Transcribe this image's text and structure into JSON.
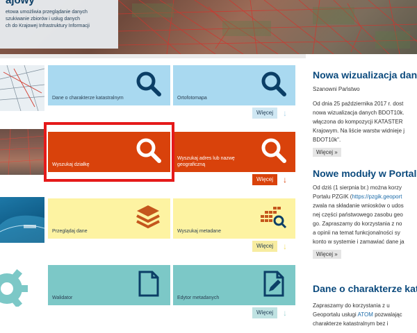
{
  "banner": {
    "title": "ajowy",
    "lines": [
      "etowa umożliwia przeglądanie danych",
      "szukiwanie zbiorów i usług danych",
      "ch do Krajowej Infrastruktury Informacji"
    ]
  },
  "tiles": [
    {
      "label": "Dane o charakterze katastralnym",
      "color": "blue",
      "icon": "search-icon"
    },
    {
      "label": "Ortofotomapa",
      "color": "blue",
      "icon": "search-icon"
    },
    {
      "label": "Wyszukaj działkę",
      "color": "red",
      "icon": "search-icon"
    },
    {
      "label": "Wyszukaj adres lub nazwę geograficzną",
      "color": "red",
      "icon": "search-icon"
    },
    {
      "label": "Przeglądaj dane",
      "color": "yellow",
      "icon": "layers-icon"
    },
    {
      "label": "Wyszukaj metadane",
      "color": "yellow",
      "icon": "grid-search-icon"
    },
    {
      "label": "Walidator",
      "color": "teal",
      "icon": "document-icon"
    },
    {
      "label": "Edytor metadanych",
      "color": "teal",
      "icon": "edit-document-icon"
    }
  ],
  "more_label": "Więcej",
  "news_more_label": "Więcej »",
  "news": [
    {
      "title": "Nowa wizualizacja danych",
      "lines": [
        "Szanowni Państwo",
        "",
        "Od dnia 25 października 2017 r. dost",
        "nowa wizualizacja danych BDOT10k.",
        "włączona do kompozycji KATASTER",
        "Krajowym. Na liście warstw widnieje j",
        "BDOT10k\"."
      ]
    },
    {
      "title": "Nowe moduły w Portalu",
      "lines": [
        "Od dziś (1 sierpnia br.) można korzy",
        "Portalu PZGIK (https://pzgik.geoport",
        "zwala na składanie wniosków o udos",
        "nej części państwowego zasobu geo",
        "go. Zapraszamy do korzystania z no",
        "a opinii na temat funkcjonalności sy",
        "konto w systemie i zamawiać dane ja"
      ]
    },
    {
      "title": "Dane o charakterze katas",
      "lines": [
        "Zapraszamy do korzystania z u",
        "Geoportalu usługi ATOM pozwalając",
        "charakterze katastralnym bez i"
      ]
    }
  ]
}
